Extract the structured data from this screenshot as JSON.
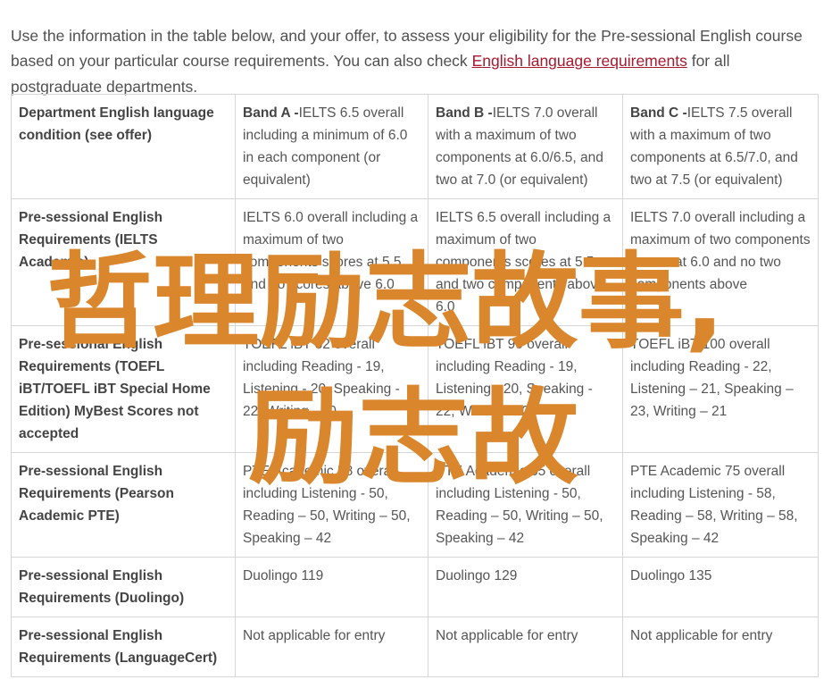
{
  "intro": {
    "text_before": "Use the information in the table below, and your offer, to assess your eligibility for the Pre-sessional English course based on your particular course requirements. You can also check ",
    "link_text": "English language requirements",
    "text_after": " for all postgraduate departments."
  },
  "table": {
    "header": {
      "label": "Department English language condition (see offer)",
      "bands": [
        {
          "band": "Band A -",
          "desc": "IELTS 6.5 overall including a minimum of 6.0 in each component (or equivalent)"
        },
        {
          "band": "Band B -",
          "desc": "IELTS 7.0 overall with a maximum of two components at 6.0/6.5, and two at 7.0 (or equivalent)"
        },
        {
          "band": "Band C -",
          "desc": "IELTS 7.5 overall with a maximum of two components at 6.5/7.0, and two at 7.5 (or equivalent)"
        }
      ]
    },
    "rows": [
      {
        "label": "Pre-sessional English Requirements (IELTS Academic)",
        "cells": [
          "IELTS 6.0 overall including a maximum of two components scores at 5.5 and no scores above 6.0",
          "IELTS 6.5 overall including a maximum of two components scores at 5.5 and two components above 6.0",
          "IELTS 7.0 overall including a maximum of two components scores at 6.0 and no two components above"
        ]
      },
      {
        "label": "Pre-sessional English Requirements (TOEFL iBT/TOEFL iBT Special Home Edition) MyBest Scores not accepted",
        "cells": [
          "TOEFL iBT 82 overall including Reading - 19, Listening - 20, Speaking - 22, Writing - 20",
          "TOEFL iBT 90 overall including Reading - 19, Listening - 20, Speaking - 22, Writing - 20",
          "TOEFL iBT 100 overall including Reading - 22, Listening – 21, Speaking – 23, Writing – 21"
        ]
      },
      {
        "label": "Pre-sessional English Requirements (Pearson Academic PTE)",
        "cells": [
          "PTE Academic 58 overall including Listening - 50, Reading – 50, Writing – 50, Speaking – 42",
          "PTE Academic 65 overall including Listening - 50, Reading – 50, Writing – 50, Speaking – 42",
          "PTE Academic 75 overall including Listening - 58, Reading – 58, Writing – 58, Speaking – 42"
        ]
      },
      {
        "label": "Pre-sessional English Requirements (Duolingo)",
        "cells": [
          "Duolingo 119",
          "Duolingo 129",
          "Duolingo 135"
        ]
      },
      {
        "label": "Pre-sessional English Requirements (LanguageCert)",
        "cells": [
          "Not applicable for entry",
          "Not applicable for entry",
          "Not applicable for entry"
        ]
      }
    ]
  },
  "watermark": {
    "line1": "哲理励志故事,",
    "line2": "励志故",
    "color": "#d9862c"
  }
}
